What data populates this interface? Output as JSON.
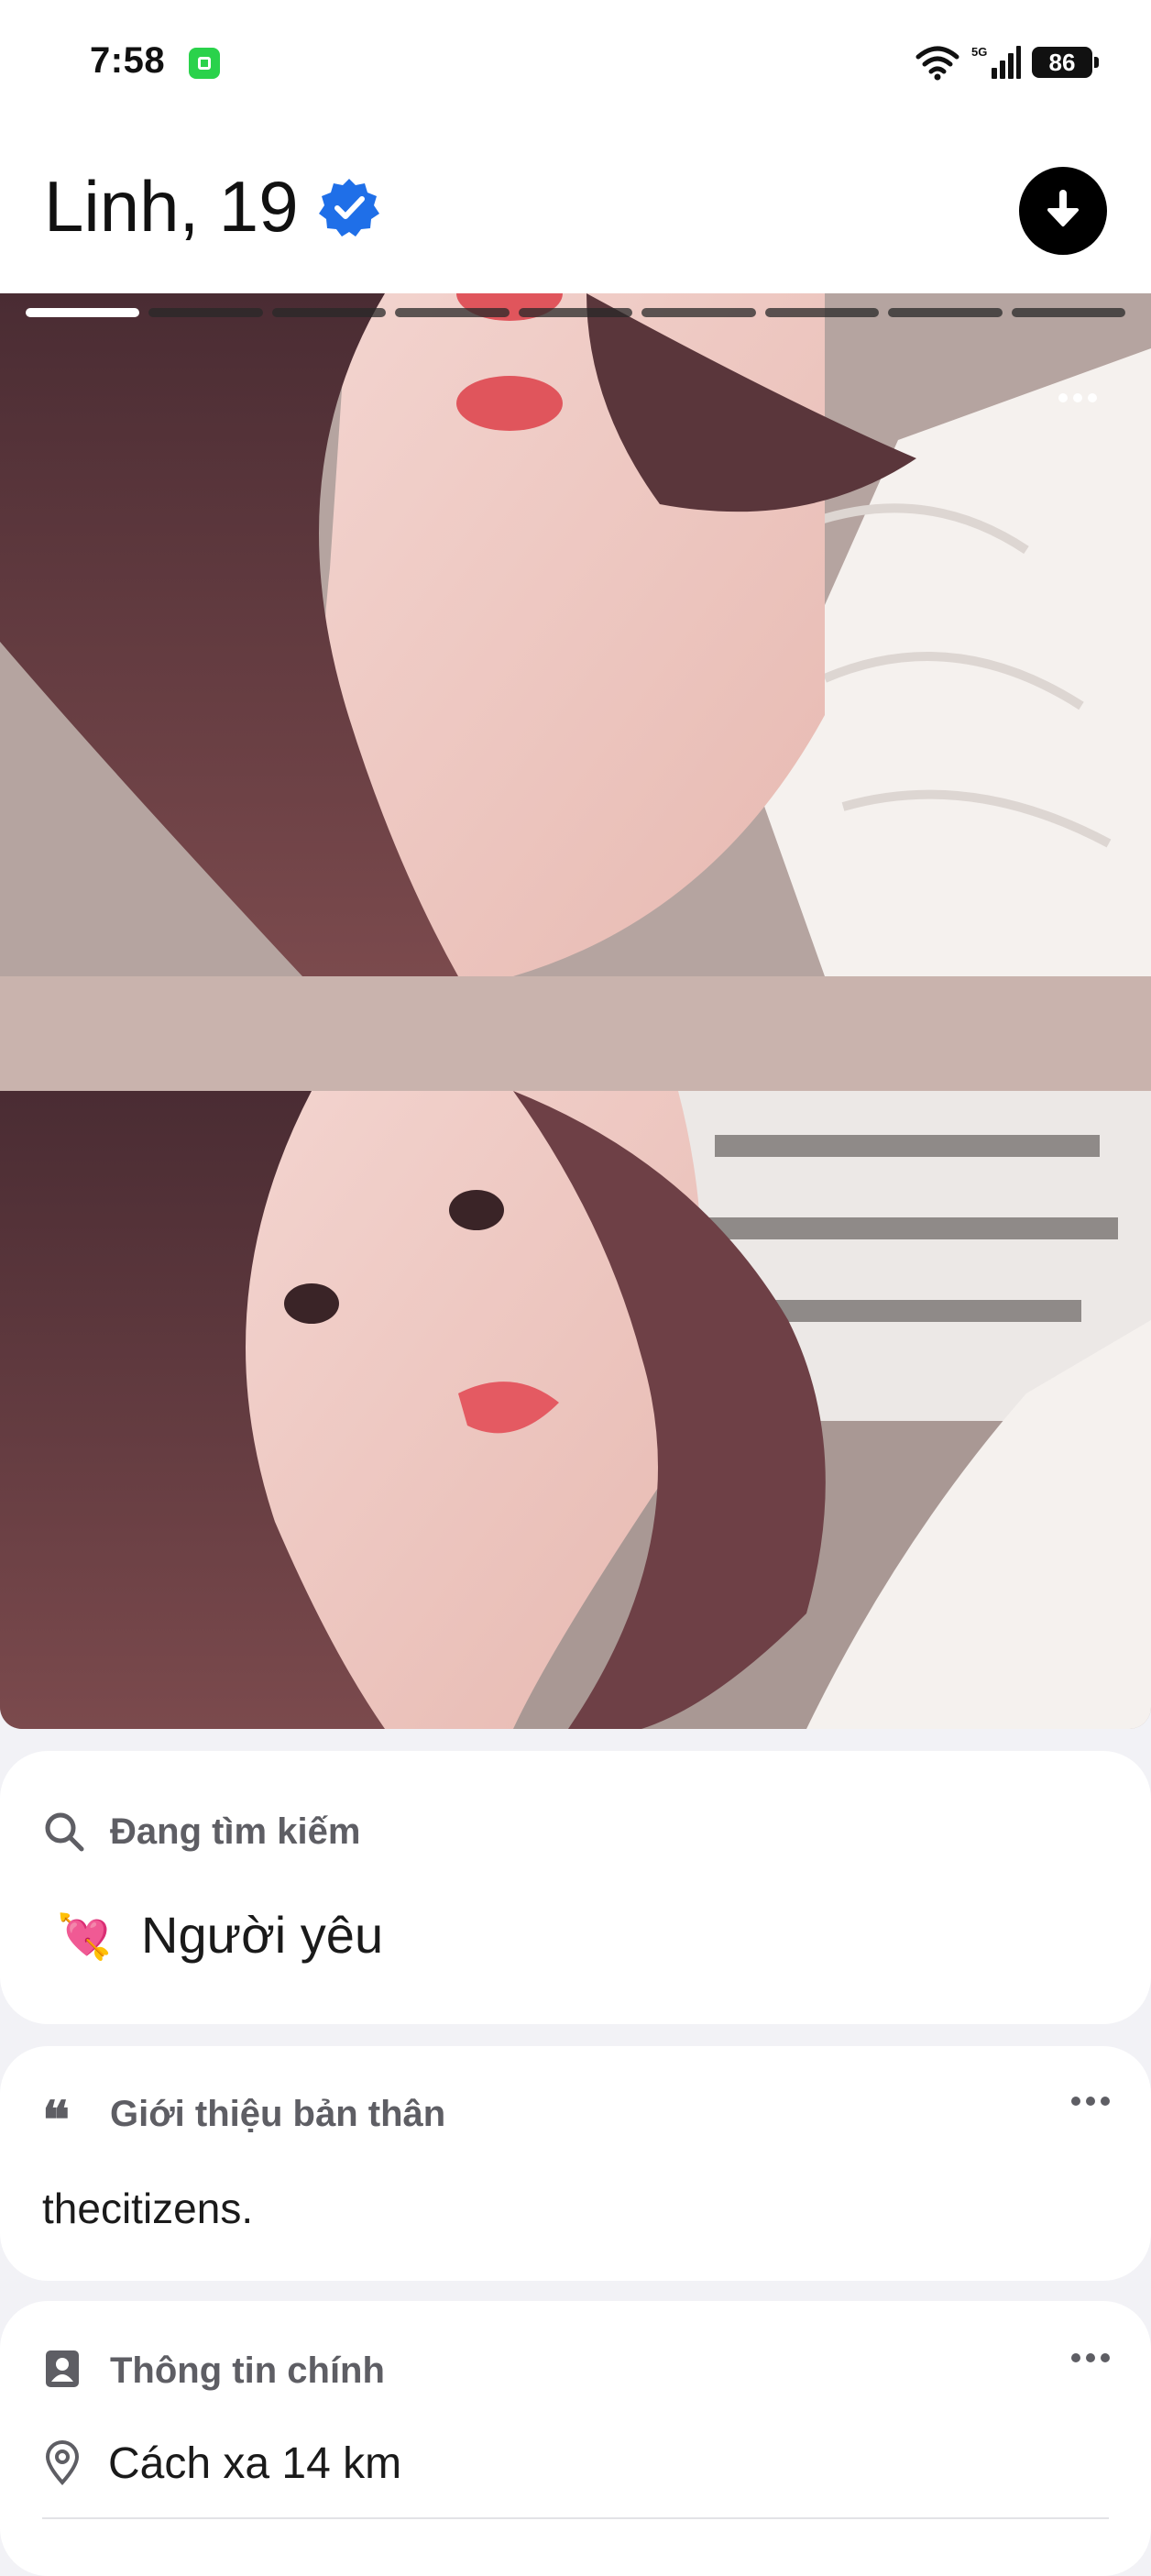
{
  "status": {
    "time": "7:58",
    "network": "5G",
    "battery": "86"
  },
  "profile": {
    "name_age": "Linh, 19"
  },
  "photos": {
    "count": 9,
    "active": 1
  },
  "looking_for": {
    "title": "Đang tìm kiếm",
    "emoji": "💘",
    "value": "Người yêu"
  },
  "about": {
    "title": "Giới thiệu bản thân",
    "text": "thecitizens."
  },
  "main_info": {
    "title": "Thông tin chính",
    "distance": "Cách xa 14 km"
  }
}
